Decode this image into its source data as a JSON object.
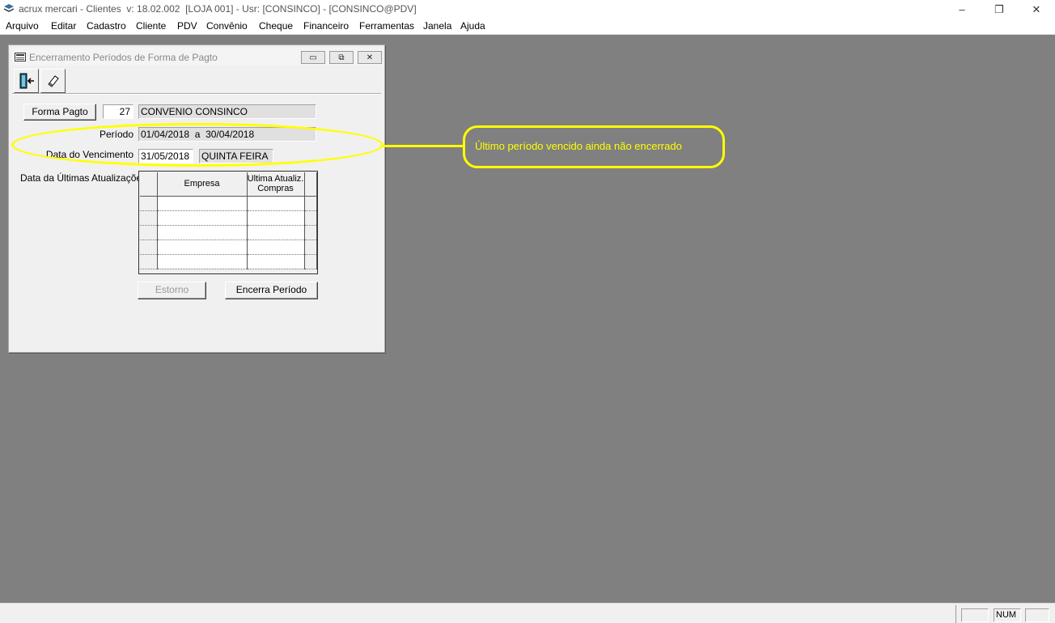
{
  "app": {
    "title": "acrux mercari - Clientes  v: 18.02.002  [LOJA 001] - Usr: [CONSINCO] - [CONSINCO@PDV]",
    "icon": "acrux-logo-icon"
  },
  "window_controls": {
    "minimize": "–",
    "restore": "❐",
    "close": "✕"
  },
  "menu": [
    {
      "label": "Arquivo"
    },
    {
      "label": "Editar"
    },
    {
      "label": "Cadastro"
    },
    {
      "label": "Cliente"
    },
    {
      "label": "PDV"
    },
    {
      "label": "Convênio"
    },
    {
      "label": "Cheque"
    },
    {
      "label": "Financeiro"
    },
    {
      "label": "Ferramentas"
    },
    {
      "label": "Janela"
    },
    {
      "label": "Ajuda"
    }
  ],
  "dialog": {
    "title": "Encerramento Períodos de Forma de Pagto",
    "controls": {
      "minimize": "▭",
      "restore": "⧉",
      "close": "✕"
    },
    "toolbar": {
      "exit_icon": "exit-door-icon",
      "eraser_icon": "eraser-icon"
    },
    "forma_pagto": {
      "button_label": "Forma Pagto",
      "code": "27",
      "description": "CONVENIO CONSINCO"
    },
    "periodo": {
      "label": "Período",
      "value": "01/04/2018  a  30/04/2018"
    },
    "vencimento": {
      "label": "Data do Vencimento",
      "date": "31/05/2018",
      "weekday": "QUINTA FEIRA"
    },
    "ultimas": {
      "label": "Data da Últimas Atualizações",
      "columns": [
        "Empresa",
        "Ultima Atualiz. Compras"
      ],
      "col_empresa": "Empresa",
      "col_ultima_1": "Ultima Atualiz.",
      "col_ultima_2": "Compras"
    },
    "buttons": {
      "estorno": "Estorno",
      "encerra": "Encerra Período"
    }
  },
  "annotation": {
    "text": "Último período vencido ainda não encerrado",
    "color": "#ffff00"
  },
  "status": {
    "num": "NUM"
  }
}
